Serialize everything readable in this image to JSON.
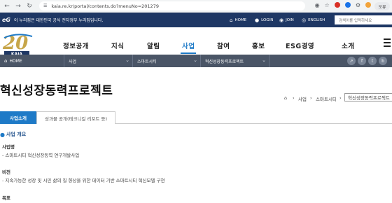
{
  "browser": {
    "url": "kaia.re.kr/portal/contents.do?menuNo=201279",
    "profile_label": "오류"
  },
  "gov_banner": {
    "logo_text": "eG",
    "text": "이 누리집은 대한민국 공식 전자정부 누리집입니다.",
    "home": "HOME",
    "login": "LOGIN",
    "join": "JOIN",
    "english": "ENGLISH",
    "search_placeholder": "검색어를 입력하세요"
  },
  "logo": {
    "number": "20",
    "brand": "KAIA"
  },
  "gnb": [
    "정보공개",
    "지식",
    "알림",
    "사업",
    "참여",
    "홍보",
    "ESG경영",
    "소개"
  ],
  "crumbs": {
    "home": "HOME",
    "level1": "사업",
    "level2": "스마트시티",
    "level3": "혁신성장동력프로젝트"
  },
  "social": [
    "f",
    "t",
    "b"
  ],
  "page": {
    "title": "혁신성장동력프로젝트",
    "loc1": "사업",
    "loc2": "스마트시티",
    "loc3": "혁신성장동력프로젝트"
  },
  "tabs": [
    "사업소개",
    "성과물 공개(테크니컬 리포트 등)"
  ],
  "section": {
    "heading": "사업 개요",
    "name_label": "사업명",
    "name_value": "- 스마트시티 혁신성장동력 연구개발사업",
    "vision_label": "비전",
    "vision_value": "- 지속가능한 성장 및 시민 삶의 질 향상을 위한 데이터 기반 스마트시티 혁신모델 구현",
    "goal_label": "목표"
  },
  "colors": {
    "navy": "#1e3764",
    "accent": "#1e7ac7",
    "crumb_bar": "#4a5566"
  }
}
